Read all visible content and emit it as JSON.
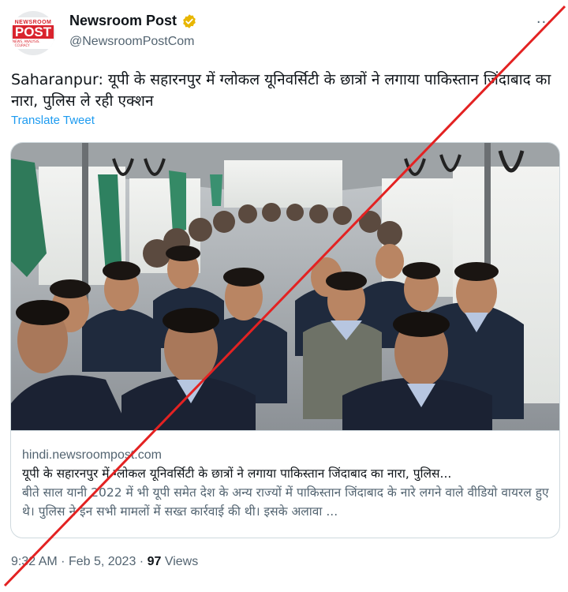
{
  "account": {
    "display_name": "Newsroom Post",
    "handle": "@NewsroomPostCom",
    "logo_text": "POST",
    "logo_top": "NEWSROOM",
    "logo_tagline": "NEWS. ANALYSIS. ACCURACY",
    "verified_color": "#e8b600",
    "more_label": "···"
  },
  "tweet": {
    "text": "Saharanpur: यूपी के सहारनपुर में ग्लोकल यूनिवर्सिटी के छात्रों ने लगाया पाकिस्तान जिंदाबाद का नारा, पुलिस ले रही एक्शन",
    "translate_label": "Translate Tweet"
  },
  "card": {
    "domain": "hindi.newsroompost.com",
    "title": "यूपी के सहारनपुर में ग्लोकल यूनिवर्सिटी के छात्रों ने लगाया पाकिस्तान जिंदाबाद का नारा, पुलिस...",
    "description": "बीते साल यानी 2022 में भी यूपी समेत देश के अन्य राज्यों में पाकिस्तान जिंदाबाद के नारे लगने वाले वीडियो वायरल हुए थे। पुलिस ने इन सभी मामलों में सख्त कार्रवाई की थी। इसके अलावा ..."
  },
  "meta": {
    "time": "9:32 AM",
    "separator": "·",
    "date": "Feb 5, 2023",
    "views_count": "97",
    "views_label": "Views"
  },
  "colors": {
    "accent": "#1d9bf0",
    "brand_red": "#d9232d",
    "cross_red": "#e32222"
  }
}
